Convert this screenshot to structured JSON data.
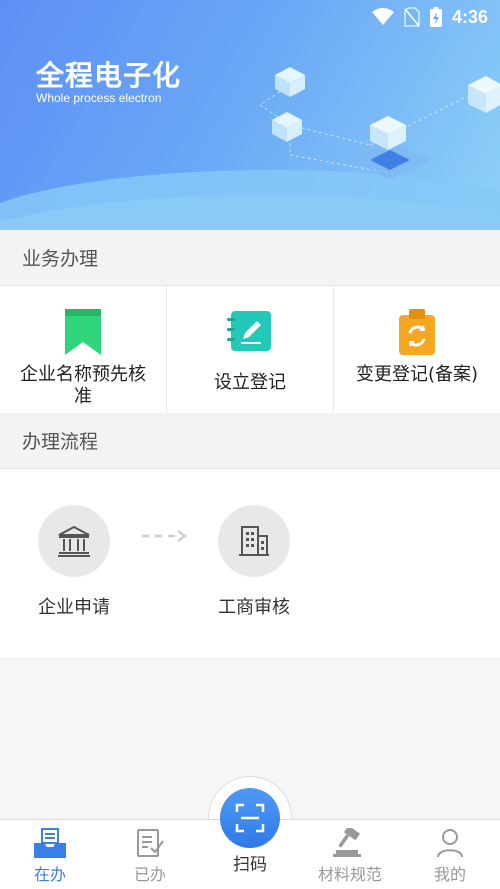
{
  "status_bar": {
    "time": "4:36"
  },
  "banner": {
    "title": "全程电子化",
    "subtitle": "Whole process electron"
  },
  "business": {
    "header": "业务办理",
    "items": [
      {
        "label": "企业名称预先核准",
        "icon": "bookmark-icon",
        "color": "#2fd47b"
      },
      {
        "label": "设立登记",
        "icon": "edit-notebook-icon",
        "color": "#23c9b8"
      },
      {
        "label": "变更登记(备案)",
        "icon": "clipboard-refresh-icon",
        "color": "#f5a623"
      }
    ]
  },
  "flow": {
    "header": "办理流程",
    "steps": [
      {
        "label": "企业申请",
        "icon": "bank-building-icon"
      },
      {
        "label": "工商审核",
        "icon": "office-building-icon"
      }
    ]
  },
  "tabbar": {
    "active_color": "#3a7ee8",
    "tabs": [
      {
        "label": "在办",
        "icon": "inbox-tray-icon",
        "active": true
      },
      {
        "label": "已办",
        "icon": "document-check-icon",
        "active": false
      },
      {
        "label": "扫码",
        "icon": "scan-icon",
        "active": false
      },
      {
        "label": "材料规范",
        "icon": "gavel-icon",
        "active": false
      },
      {
        "label": "我的",
        "icon": "user-icon",
        "active": false
      }
    ]
  }
}
